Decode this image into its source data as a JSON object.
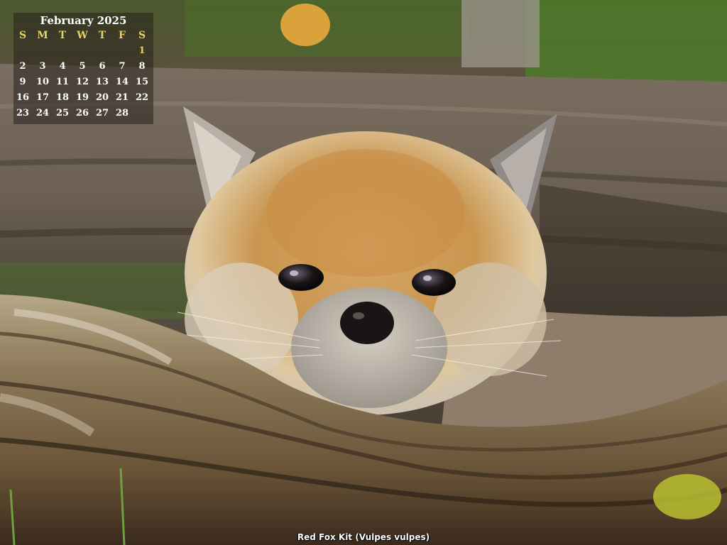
{
  "calendar": {
    "title": "February 2025",
    "weekdays": [
      "S",
      "M",
      "T",
      "W",
      "T",
      "F",
      "S"
    ],
    "weeks": [
      [
        "",
        "",
        "",
        "",
        "",
        "",
        "1"
      ],
      [
        "2",
        "3",
        "4",
        "5",
        "6",
        "7",
        "8"
      ],
      [
        "9",
        "10",
        "11",
        "12",
        "13",
        "14",
        "15"
      ],
      [
        "16",
        "17",
        "18",
        "19",
        "20",
        "21",
        "22"
      ],
      [
        "23",
        "24",
        "25",
        "26",
        "27",
        "28",
        ""
      ]
    ]
  },
  "wallpaper": {
    "caption": "Red Fox Kit (Vulpes vulpes)"
  },
  "colors": {
    "weekend_accent": "#e8d060",
    "calendar_text": "#ffffff"
  }
}
